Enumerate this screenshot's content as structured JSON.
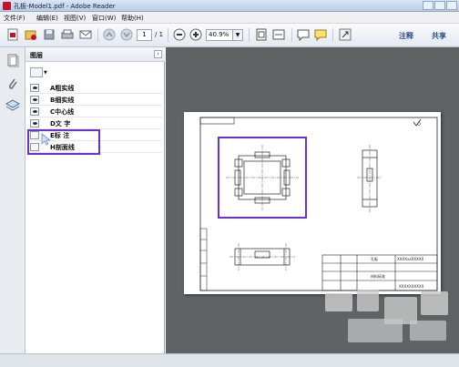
{
  "window": {
    "title": "孔板-Model1.pdf - Adobe Reader"
  },
  "menu": {
    "items": [
      "文件(F)",
      "编辑(E)",
      "视图(V)",
      "窗口(W)",
      "帮助(H)"
    ]
  },
  "toolbar": {
    "page_current": "1",
    "page_total": "/ 1",
    "zoom": "40.9%",
    "annotate_label": "注释",
    "share_label": "共享",
    "icons": [
      "create-pdf-icon",
      "open-icon",
      "save-icon",
      "print-icon",
      "email-icon",
      "prev-page-icon",
      "next-page-icon",
      "zoom-out-icon",
      "zoom-in-icon",
      "fit-page-icon",
      "fit-width-icon",
      "comment-icon",
      "highlight-icon",
      "expand-icon"
    ]
  },
  "layers_panel": {
    "title": "图层",
    "layers": [
      {
        "name": "A粗实线",
        "visible": true
      },
      {
        "name": "B细实线",
        "visible": true
      },
      {
        "name": "C中心线",
        "visible": true
      },
      {
        "name": "D文  字",
        "visible": true
      },
      {
        "name": "E标  注",
        "visible": false
      },
      {
        "name": "H剖面线",
        "visible": false
      }
    ]
  },
  "drawing": {
    "title_block_texts": [
      "孔板",
      "XXXXxxXXXXX",
      "XXXXXXXXXX",
      "材料标准"
    ],
    "highlight_color": "#6a2fd6"
  }
}
